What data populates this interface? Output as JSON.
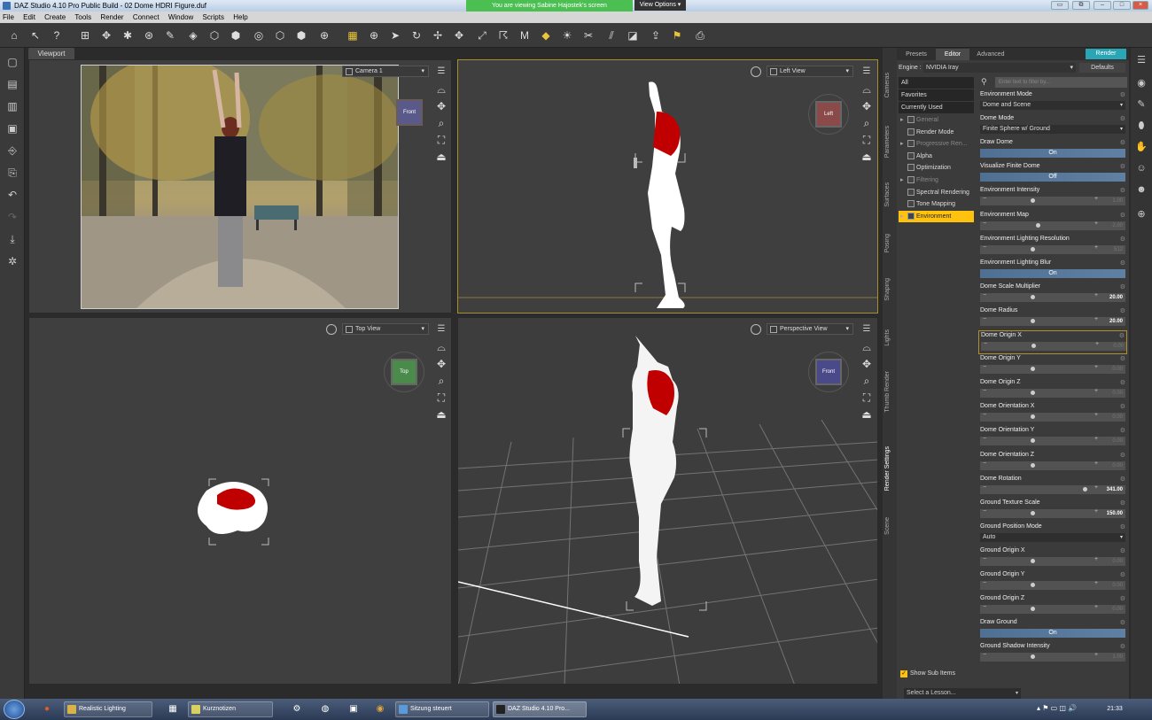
{
  "window": {
    "title": "DAZ Studio 4.10 Pro Public Build - 02 Dome HDRI Figure.duf",
    "banner": "You are viewing Sabine Hajostek's screen",
    "view_options": "View Options"
  },
  "menu": [
    "File",
    "Edit",
    "Create",
    "Tools",
    "Render",
    "Connect",
    "Window",
    "Scripts",
    "Help"
  ],
  "viewport": {
    "tab": "Viewport",
    "views": [
      {
        "camera": "Camera 1",
        "cube": "Front"
      },
      {
        "camera": "Left View",
        "cube": "Left"
      },
      {
        "camera": "Top View",
        "cube": "Top"
      },
      {
        "camera": "Perspective View",
        "cube": "Front"
      }
    ]
  },
  "side_tabs": [
    "Cameras",
    "Parameters",
    "Surfaces",
    "Posing",
    "Shaping",
    "Lights",
    "Thumb Render",
    "Render Settings",
    "Scene"
  ],
  "panel": {
    "tabs": [
      "Presets",
      "Editor",
      "Advanced"
    ],
    "render_button": "Render",
    "engine_label": "Engine :",
    "engine_value": "NVIDIA Iray",
    "defaults": "Defaults",
    "filter_placeholder": "Enter text to filter by...",
    "categories": [
      "All",
      "Favorites",
      "Currently Used"
    ],
    "subcategories": [
      {
        "label": "General",
        "dim": true,
        "arrow": true
      },
      {
        "label": "Render Mode",
        "dim": false,
        "arrow": false
      },
      {
        "label": "Progressive Ren...",
        "dim": true,
        "arrow": true
      },
      {
        "label": "Alpha",
        "dim": false,
        "arrow": false
      },
      {
        "label": "Optimization",
        "dim": false,
        "arrow": false
      },
      {
        "label": "Filtering",
        "dim": true,
        "arrow": true
      },
      {
        "label": "Spectral Rendering",
        "dim": false,
        "arrow": false
      },
      {
        "label": "Tone Mapping",
        "dim": false,
        "arrow": false
      },
      {
        "label": "Environment",
        "dim": false,
        "arrow": true,
        "selected": true
      }
    ],
    "properties": [
      {
        "label": "Environment Mode",
        "kind": "dropdown",
        "value": "Dome and Scene"
      },
      {
        "label": "Dome Mode",
        "kind": "dropdown",
        "value": "Finite Sphere w/ Ground"
      },
      {
        "label": "Draw Dome",
        "kind": "toggle",
        "value": "On"
      },
      {
        "label": "Visualize Finite Dome",
        "kind": "toggle",
        "value": "Off"
      },
      {
        "label": "Environment Intensity",
        "kind": "slider",
        "value": "1.00",
        "level": 0.42
      },
      {
        "label": "Environment Map",
        "kind": "slider",
        "value": "2.00",
        "level": 0.47
      },
      {
        "label": "Environment Lighting Resolution",
        "kind": "slider",
        "value": "512",
        "level": 0.42
      },
      {
        "label": "Environment Lighting Blur",
        "kind": "toggle",
        "value": "On"
      },
      {
        "label": "Dome Scale Multiplier",
        "kind": "slider",
        "value": "20.00",
        "level": 0.42,
        "bright": true
      },
      {
        "label": "Dome Radius",
        "kind": "slider",
        "value": "20.00",
        "level": 0.42,
        "bright": true
      },
      {
        "label": "Dome Origin X",
        "kind": "slider",
        "value": "0.00",
        "level": 0.42,
        "highlight": true
      },
      {
        "label": "Dome Origin Y",
        "kind": "slider",
        "value": "0.00",
        "level": 0.42
      },
      {
        "label": "Dome Origin Z",
        "kind": "slider",
        "value": "0.00",
        "level": 0.42
      },
      {
        "label": "Dome Orientation X",
        "kind": "slider",
        "value": "0.00",
        "level": 0.42
      },
      {
        "label": "Dome Orientation Y",
        "kind": "slider",
        "value": "0.00",
        "level": 0.42
      },
      {
        "label": "Dome Orientation Z",
        "kind": "slider",
        "value": "0.00",
        "level": 0.42
      },
      {
        "label": "Dome Rotation",
        "kind": "slider",
        "value": "341.00",
        "level": 0.95,
        "bright": true
      },
      {
        "label": "Ground Texture Scale",
        "kind": "slider",
        "value": "150.00",
        "level": 0.42,
        "bright": true
      },
      {
        "label": "Ground Position Mode",
        "kind": "dropdown",
        "value": "Auto"
      },
      {
        "label": "Ground Origin X",
        "kind": "slider",
        "value": "0.00",
        "level": 0.42
      },
      {
        "label": "Ground Origin Y",
        "kind": "slider",
        "value": "0.00",
        "level": 0.42
      },
      {
        "label": "Ground Origin Z",
        "kind": "slider",
        "value": "0.00",
        "level": 0.42
      },
      {
        "label": "Draw Ground",
        "kind": "toggle",
        "value": "On"
      },
      {
        "label": "Ground Shadow Intensity",
        "kind": "slider",
        "value": "1.00",
        "level": 0.42
      }
    ],
    "show_sub_items": "Show Sub Items",
    "lesson": "Select a Lesson..."
  },
  "taskbar": {
    "tasks": [
      "Realistic Lighting",
      "Kurznotizen",
      "Sitzung steuert",
      "DAZ Studio 4.10 Pro..."
    ],
    "clock": "21:33"
  },
  "colors": {
    "accent": "#ffc20e",
    "render": "#2aa5b5",
    "selection_red": "#c00000"
  }
}
